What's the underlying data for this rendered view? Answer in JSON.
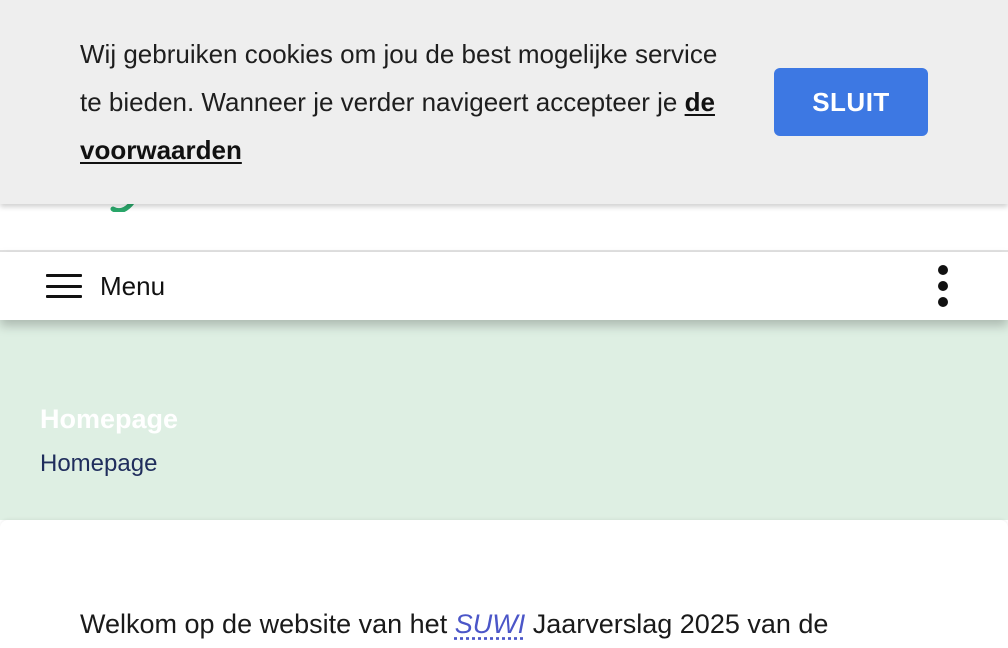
{
  "cookie_banner": {
    "message": "Wij gebruiken cookies om jou de best mogelijke service te bieden. Wanneer je verder navigeert accepteer je ",
    "link_text": "de voorwaarden",
    "close_label": "SLUIT",
    "button_color": "#3d78e3",
    "background_color": "#eeeeee"
  },
  "nav": {
    "menu_label": "Menu",
    "menu_icon": "hamburger-icon",
    "more_icon": "more-vertical-icon"
  },
  "hero": {
    "title": "Homepage",
    "breadcrumb": "Homepage",
    "background_color": "#deefe3"
  },
  "content": {
    "intro_before": "Welkom op de website van het ",
    "intro_link": "SUWI",
    "intro_after": " Jaarverslag 2025 van de"
  },
  "colors": {
    "logo_accent": "#2aa86b",
    "link": "#4b56c8",
    "breadcrumb": "#1f2d5c"
  }
}
